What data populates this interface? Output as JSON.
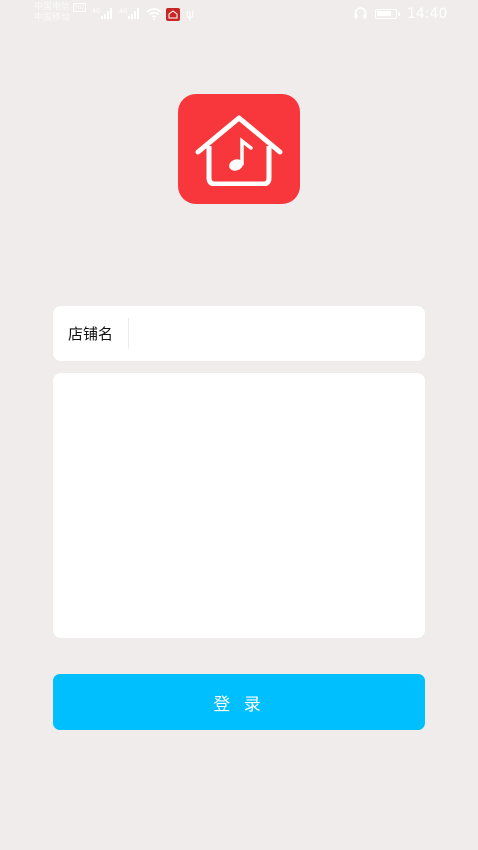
{
  "status_bar": {
    "carrier_1": "中国电信",
    "carrier_2": "中国移动",
    "hd_badge": "HD",
    "sig1_tag": "4G",
    "sig2_tag": "4G",
    "time": "14:40"
  },
  "form": {
    "store_label": "店铺名",
    "store_value": "",
    "store_placeholder": "",
    "content_value": ""
  },
  "login": {
    "label": "登 录"
  },
  "colors": {
    "background": "#f0eceb",
    "logo": "#f7373b",
    "button": "#00bfff"
  },
  "icons": {
    "logo": "house-music-note-icon"
  }
}
